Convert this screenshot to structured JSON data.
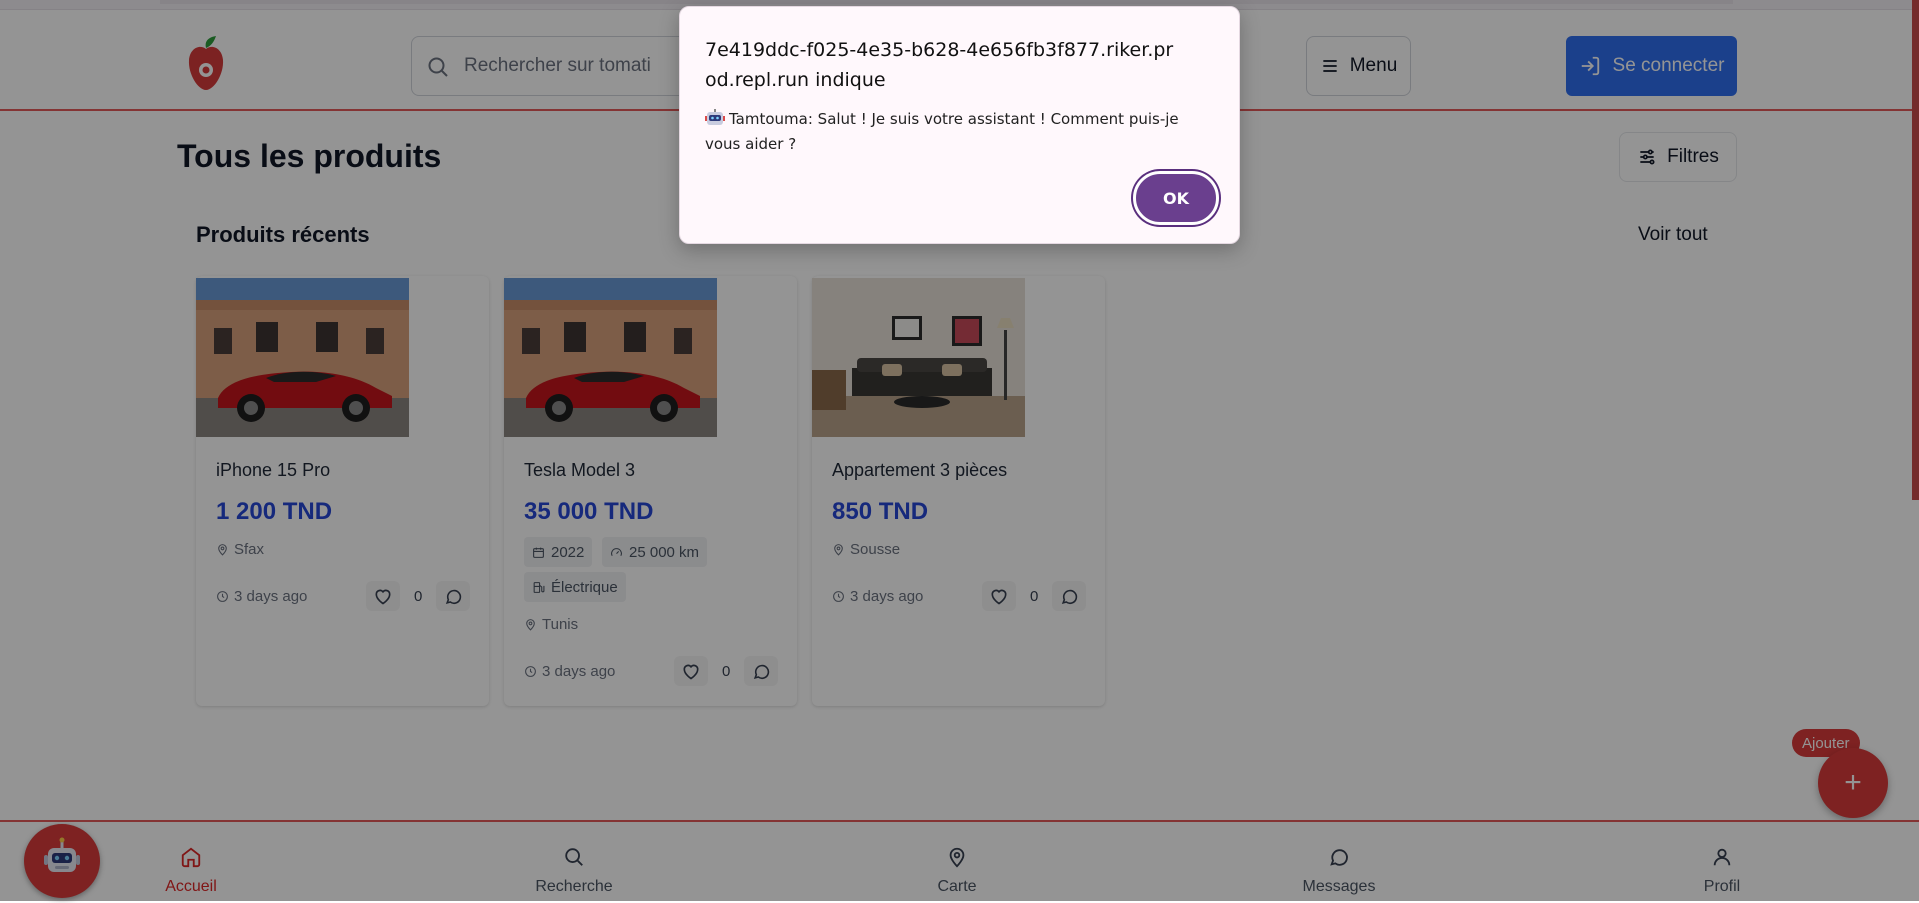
{
  "header": {
    "search_placeholder": "Rechercher sur tomati",
    "menu_label": "Menu",
    "login_label": "Se connecter"
  },
  "main": {
    "title": "Tous les produits",
    "filters_label": "Filtres",
    "section_title": "Produits récents",
    "see_all_label": "Voir tout"
  },
  "products": [
    {
      "name": "iPhone 15 Pro",
      "price": "1 200 TND",
      "location": "Sfax",
      "time": "3 days ago",
      "likes": "0"
    },
    {
      "name": "Tesla Model 3",
      "price": "35 000 TND",
      "year": "2022",
      "mileage": "25 000 km",
      "fuel": "Électrique",
      "location": "Tunis",
      "time": "3 days ago",
      "likes": "0"
    },
    {
      "name": "Appartement 3 pièces",
      "price": "850 TND",
      "location": "Sousse",
      "time": "3 days ago",
      "likes": "0"
    }
  ],
  "bottom_nav": {
    "items": [
      {
        "label": "Accueil",
        "icon": "home-icon",
        "active": true
      },
      {
        "label": "Recherche",
        "icon": "search-icon",
        "active": false
      },
      {
        "label": "Carte",
        "icon": "map-pin-icon",
        "active": false
      },
      {
        "label": "Messages",
        "icon": "message-icon",
        "active": false
      },
      {
        "label": "Profil",
        "icon": "user-icon",
        "active": false
      }
    ]
  },
  "fab": {
    "label": "Ajouter",
    "symbol": "+"
  },
  "dialog": {
    "title": "7e419ddc-f025-4e35-b628-4e656fb3f877.riker.prod.repl.run indique",
    "message": "Tamtouma: Salut ! Je suis votre assistant ! Comment puis-je vous aider ?",
    "ok_label": "OK"
  },
  "colors": {
    "primary_red": "#d93b3b",
    "primary_blue": "#2f6ef0",
    "price_blue": "#2747d6",
    "dialog_button": "#6a3f8e"
  }
}
